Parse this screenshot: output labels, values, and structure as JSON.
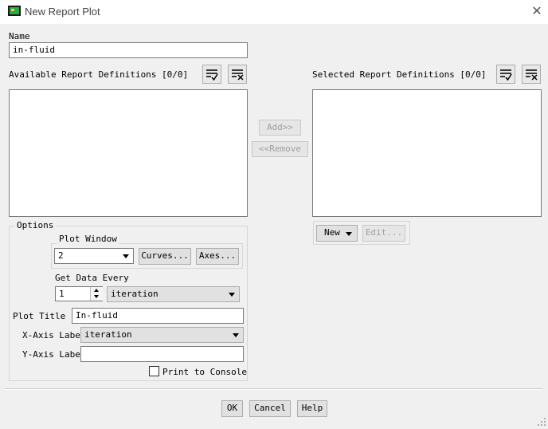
{
  "window": {
    "title": "New Report Plot"
  },
  "name": {
    "label": "Name",
    "value": "in-fluid"
  },
  "available": {
    "label": "Available Report Definitions [0/0]"
  },
  "selected": {
    "label": "Selected Report Definitions [0/0]"
  },
  "middle_buttons": {
    "add": "Add>>",
    "remove": "<<Remove"
  },
  "right_buttons": {
    "new": "New",
    "edit": "Edit..."
  },
  "options": {
    "label": "Options",
    "plot_window": {
      "label": "Plot Window",
      "value": "2",
      "curves": "Curves...",
      "axes": "Axes..."
    },
    "get_data_every": {
      "label": "Get Data Every",
      "count": "1",
      "unit": "iteration"
    },
    "plot_title": {
      "label": "Plot Title",
      "value": "In-fluid"
    },
    "x_axis_label": {
      "label": "X-Axis Label",
      "value": "iteration"
    },
    "y_axis_label": {
      "label": "Y-Axis Label",
      "value": ""
    },
    "print_to_console": {
      "label": "Print to Console",
      "checked": false
    }
  },
  "footer": {
    "ok": "OK",
    "cancel": "Cancel",
    "help": "Help"
  },
  "icons": {
    "app": "fluent-app-icon",
    "select_all": "select-all-list-icon",
    "deselect_all": "deselect-all-list-icon",
    "close": "close-icon"
  }
}
